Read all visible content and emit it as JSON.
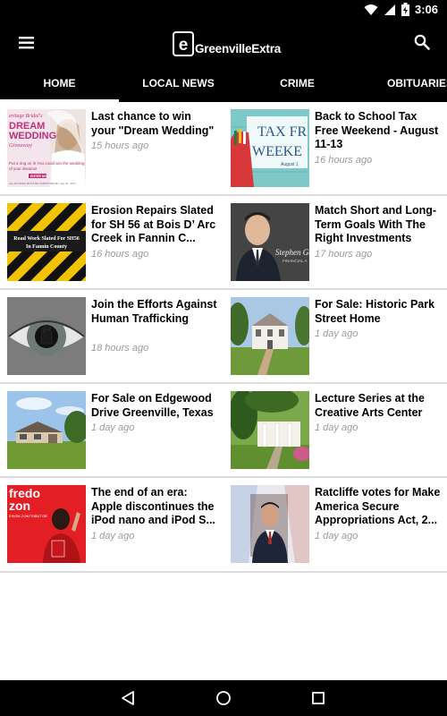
{
  "status": {
    "time": "3:06"
  },
  "app": {
    "name": "GreenvilleExtra",
    "logo_letter": "e"
  },
  "tabs": [
    {
      "label": "HOME"
    },
    {
      "label": "LOCAL NEWS"
    },
    {
      "label": "CRIME"
    },
    {
      "label": "OBITUARIES"
    }
  ],
  "articles": [
    {
      "title": "Last chance to win your \"Dream Wedding\"",
      "time": "15 hours ago"
    },
    {
      "title": "Back to School Tax Free Weekend - August 11-13",
      "time": "16 hours ago"
    },
    {
      "title": "Erosion Repairs Slated for SH 56 at Bois D’ Arc Creek in Fannin C...",
      "time": "16 hours ago"
    },
    {
      "title": "Match Short and Long-Term Goals With The Right Investments",
      "time": "17 hours ago"
    },
    {
      "title": "Join the Efforts Against Human Trafficking",
      "time": "18 hours ago"
    },
    {
      "title": "For Sale: Historic Park Street Home",
      "time": "1 day ago"
    },
    {
      "title": "For Sale on Edgewood Drive Greenville, Texas",
      "time": "1 day ago"
    },
    {
      "title": "Lecture Series at the Creative Arts Center",
      "time": "1 day ago"
    },
    {
      "title": "The end of an era: Apple discontinues the iPod nano and iPod S...",
      "time": "1 day ago"
    },
    {
      "title": "Ratcliffe votes for Make America Secure Appropriations Act, 2...",
      "time": "1 day ago"
    }
  ],
  "thumb_text": {
    "wedding_brand": "eritage Bridal's",
    "wedding_title1": "DREAM",
    "wedding_title2": "WEDDING",
    "wedding_sub": "Giveaway",
    "wedding_line1": "Put a ring on it! You could win the wedding",
    "wedding_line2": "of your dreams!",
    "wedding_button": "ENTER NOW",
    "wedding_fine": "ALL ENTRIES MUST BE SUBMITTED BY July 31, 2017",
    "tax_line1": "TAX FR",
    "tax_line2": "WEEKE",
    "tax_date": "August 1",
    "road_line1": "Road Work Slated For SH56",
    "road_line2": "In Fannin County",
    "invest_name": "Stephen Ge",
    "invest_sub": "FINANCIAL A",
    "ipod_line1": "fredo",
    "ipod_line2": "zon",
    "ipod_line3": "ESIGN CONTRIBUTOR"
  },
  "colors": {
    "bar": "#000000",
    "divider": "#dcdcdc",
    "time": "#9a9a9a",
    "tax_teal": "#7fc8c9",
    "road_yellow": "#f2c300",
    "ipod_red": "#e31e24"
  }
}
